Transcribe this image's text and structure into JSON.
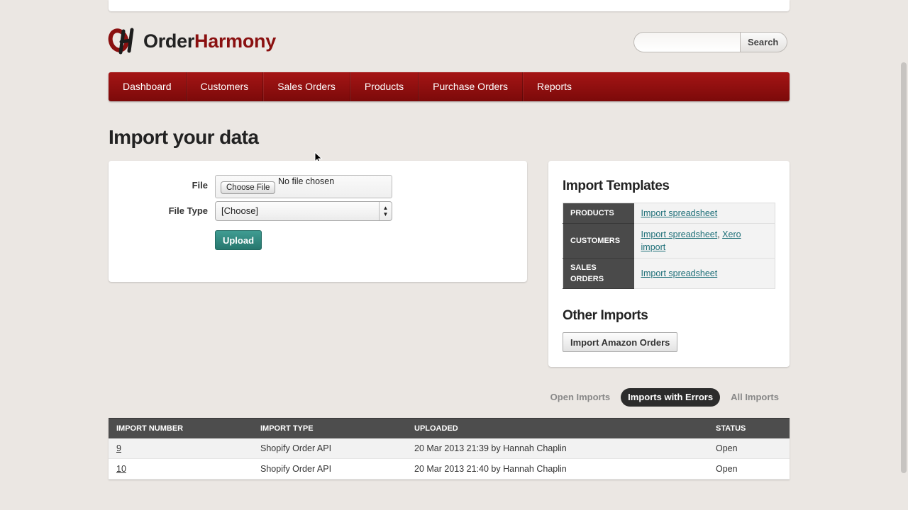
{
  "brand": {
    "name_part1": "Order",
    "name_part2": "Harmony",
    "accent_color": "#8a1010"
  },
  "search": {
    "placeholder": "",
    "button_label": "Search"
  },
  "nav": {
    "items": [
      {
        "label": "Dashboard"
      },
      {
        "label": "Customers"
      },
      {
        "label": "Sales Orders"
      },
      {
        "label": "Products"
      },
      {
        "label": "Purchase Orders"
      },
      {
        "label": "Reports"
      }
    ]
  },
  "page": {
    "title": "Import your data"
  },
  "upload_form": {
    "file_label": "File",
    "choose_button": "Choose File",
    "no_file_text": "No file chosen",
    "file_type_label": "File Type",
    "file_type_value": "[Choose]",
    "upload_button": "Upload"
  },
  "templates": {
    "title": "Import Templates",
    "rows": [
      {
        "label": "PRODUCTS",
        "link1": "Import spreadsheet"
      },
      {
        "label": "CUSTOMERS",
        "link1": "Import spreadsheet",
        "separator": ", ",
        "link2": "Xero import"
      },
      {
        "label": "SALES ORDERS",
        "link1": "Import spreadsheet"
      }
    ]
  },
  "other_imports": {
    "title": "Other Imports",
    "amazon_button": "Import Amazon Orders"
  },
  "filter_tabs": {
    "open": "Open Imports",
    "errors": "Imports with Errors",
    "all": "All Imports",
    "active": "errors"
  },
  "imports_table": {
    "headers": [
      "IMPORT NUMBER",
      "IMPORT TYPE",
      "UPLOADED",
      "STATUS"
    ],
    "rows": [
      {
        "number": "9",
        "type": "Shopify Order API",
        "uploaded": "20 Mar 2013 21:39 by Hannah Chaplin",
        "status": "Open"
      },
      {
        "number": "10",
        "type": "Shopify Order API",
        "uploaded": "20 Mar 2013 21:40 by Hannah Chaplin",
        "status": "Open"
      }
    ]
  }
}
